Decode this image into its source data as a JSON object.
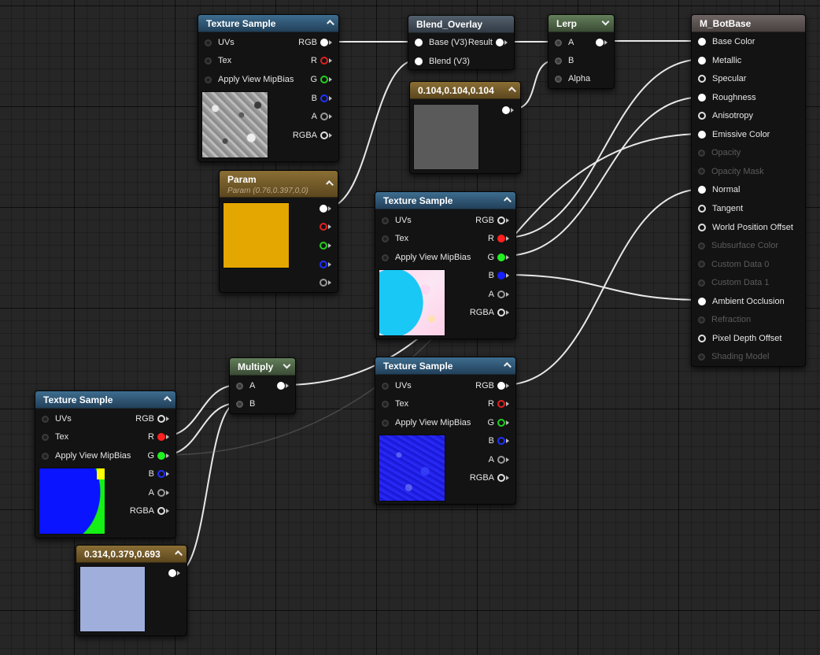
{
  "colors": {
    "vector_const": "#5a5a5a",
    "param": "#e4a600",
    "normal_const": "#a0aedc",
    "wire": "#e8e8e8"
  },
  "nodes": {
    "tex1": {
      "title": "Texture Sample",
      "inputs": [
        "UVs",
        "Tex",
        "Apply View MipBias"
      ],
      "outputs": [
        "RGB",
        "R",
        "G",
        "B",
        "A",
        "RGBA"
      ]
    },
    "param": {
      "title": "Param",
      "subtitle": "Param (0.76,0.397,0,0)"
    },
    "blend": {
      "title": "Blend_Overlay",
      "inputs": [
        "Base (V3)",
        "Blend (V3)"
      ],
      "outputs": [
        "Result"
      ]
    },
    "const104": {
      "title": "0.104,0.104,0.104"
    },
    "lerp": {
      "title": "Lerp",
      "inputs": [
        "A",
        "B",
        "Alpha"
      ]
    },
    "tex2": {
      "title": "Texture Sample",
      "inputs": [
        "UVs",
        "Tex",
        "Apply View MipBias"
      ],
      "outputs": [
        "RGB",
        "R",
        "G",
        "B",
        "A",
        "RGBA"
      ]
    },
    "tex3": {
      "title": "Texture Sample",
      "inputs": [
        "UVs",
        "Tex",
        "Apply View MipBias"
      ],
      "outputs": [
        "RGB",
        "R",
        "G",
        "B",
        "A",
        "RGBA"
      ]
    },
    "multiply": {
      "title": "Multiply",
      "inputs": [
        "A",
        "B"
      ]
    },
    "tex4": {
      "title": "Texture Sample",
      "inputs": [
        "UVs",
        "Tex",
        "Apply View MipBias"
      ],
      "outputs": [
        "RGB",
        "R",
        "G",
        "B",
        "A",
        "RGBA"
      ]
    },
    "const314": {
      "title": "0.314,0.379,0.693"
    },
    "material": {
      "title": "M_BotBase",
      "inputs": [
        {
          "label": "Base Color",
          "state": "connected"
        },
        {
          "label": "Metallic",
          "state": "connected"
        },
        {
          "label": "Specular",
          "state": "open"
        },
        {
          "label": "Roughness",
          "state": "connected"
        },
        {
          "label": "Anisotropy",
          "state": "open"
        },
        {
          "label": "Emissive Color",
          "state": "connected"
        },
        {
          "label": "Opacity",
          "state": "disabled"
        },
        {
          "label": "Opacity Mask",
          "state": "disabled"
        },
        {
          "label": "Normal",
          "state": "connected"
        },
        {
          "label": "Tangent",
          "state": "open"
        },
        {
          "label": "World Position Offset",
          "state": "open"
        },
        {
          "label": "Subsurface Color",
          "state": "disabled"
        },
        {
          "label": "Custom Data 0",
          "state": "disabled"
        },
        {
          "label": "Custom Data 1",
          "state": "disabled"
        },
        {
          "label": "Ambient Occlusion",
          "state": "connected"
        },
        {
          "label": "Refraction",
          "state": "disabled"
        },
        {
          "label": "Pixel Depth Offset",
          "state": "open"
        },
        {
          "label": "Shading Model",
          "state": "disabled"
        }
      ]
    }
  }
}
